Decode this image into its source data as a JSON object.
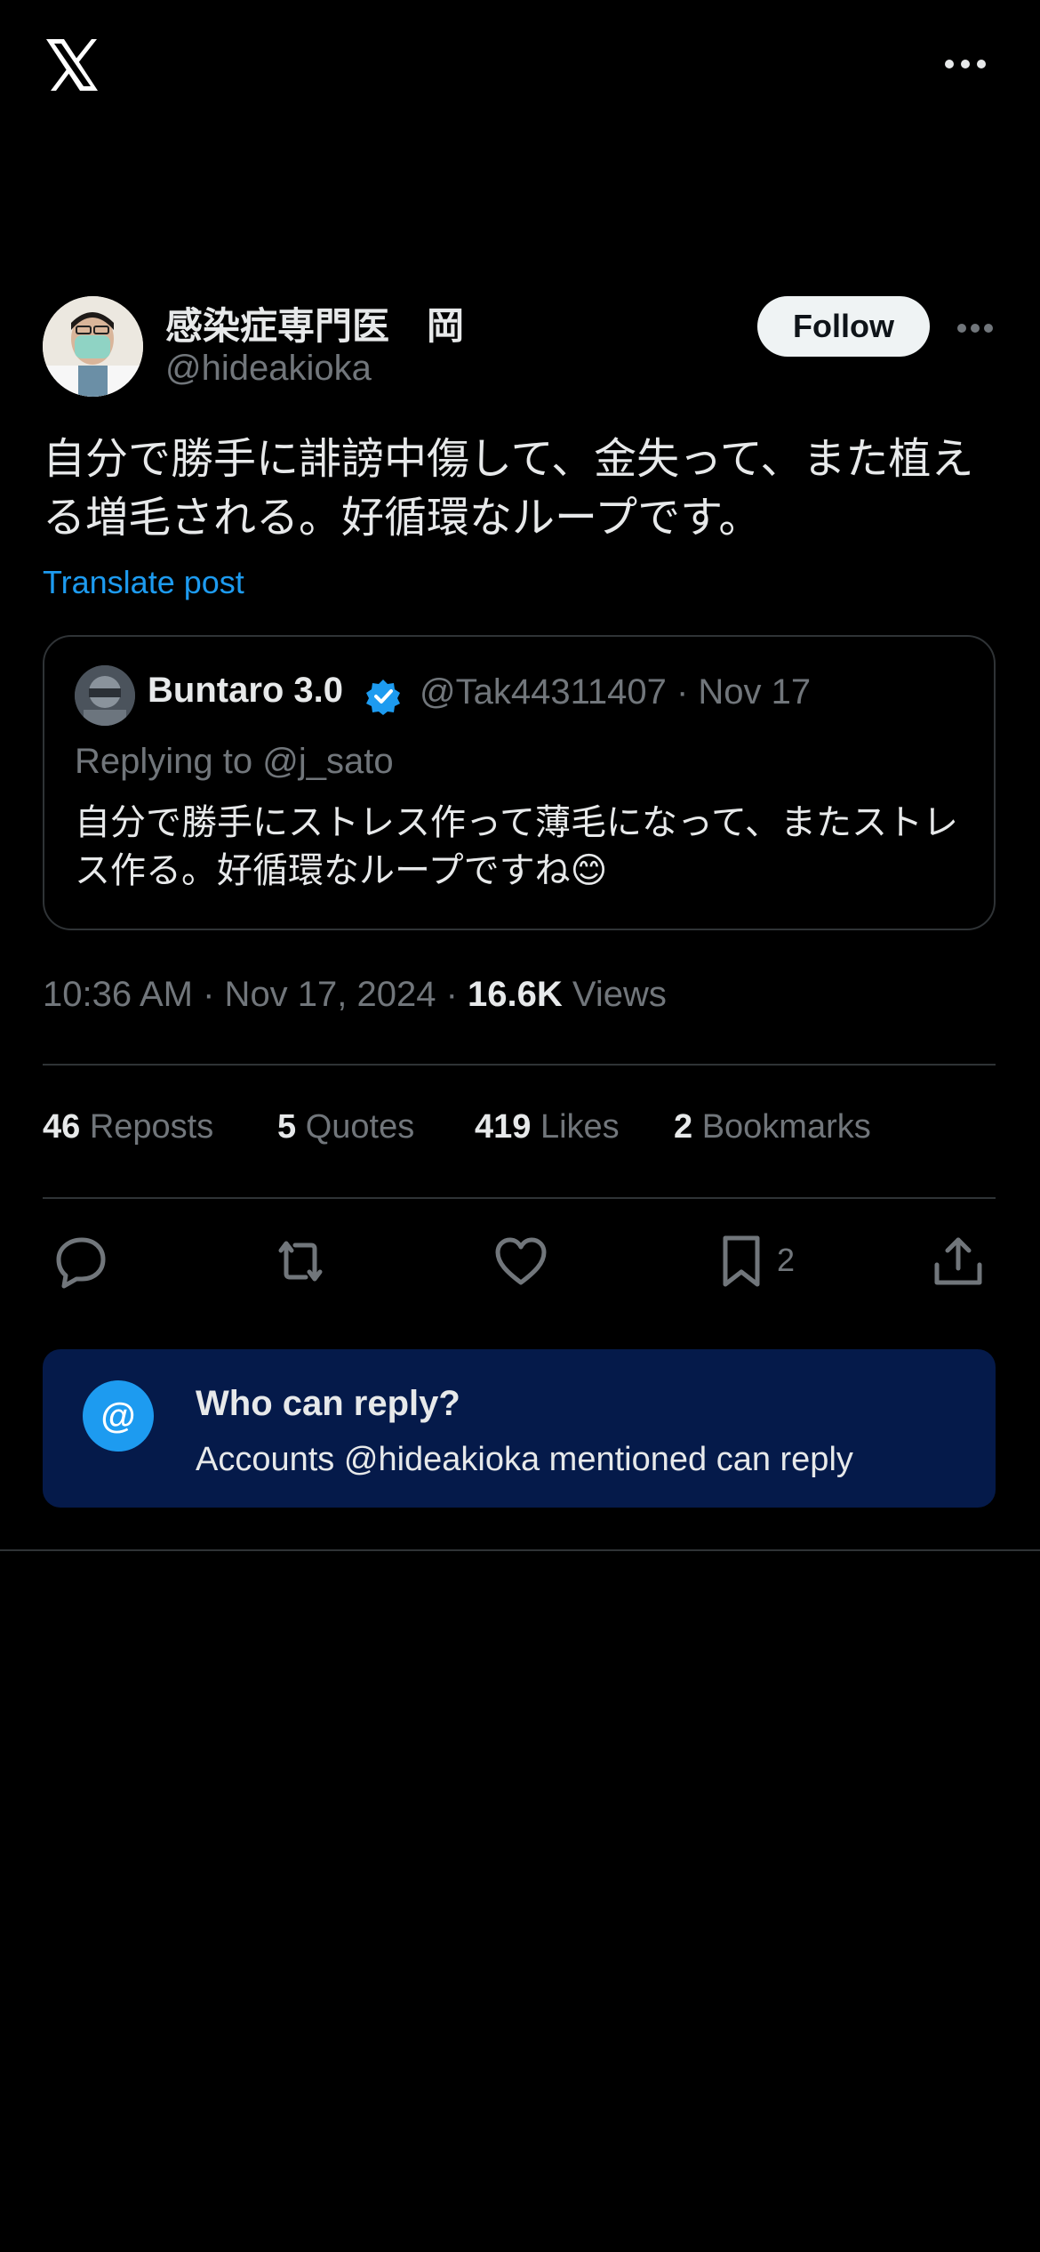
{
  "header": {
    "logo_icon": "x-logo-icon",
    "more_icon": "more-horizontal-icon"
  },
  "author": {
    "name": "感染症専門医　岡",
    "handle": "@hideakioka",
    "follow_label": "Follow"
  },
  "post": {
    "text": "自分で勝手に誹謗中傷して、金失って、また植える増毛される。好循環なループです。",
    "translate_label": "Translate post"
  },
  "quote": {
    "name": "Buntaro 3.0",
    "verified_icon": "verified-badge-icon",
    "meta": "@Tak44311407 · Nov 17",
    "replying_to": "Replying to @j_sato",
    "text": "自分で勝手にストレス作って薄毛になって、またストレス作る。好循環なループですね😊"
  },
  "meta": {
    "time_date": "10:36 AM · Nov 17, 2024 · ",
    "views_count": "16.6K",
    "views_label": " Views"
  },
  "stats": {
    "reposts_count": "46",
    "reposts_label": " Reposts",
    "quotes_count": "5",
    "quotes_label": " Quotes",
    "likes_count": "419",
    "likes_label": " Likes",
    "bookmarks_count": "2",
    "bookmarks_label": " Bookmarks"
  },
  "actions": {
    "bookmark_count": "2"
  },
  "reply_settings": {
    "symbol": "@",
    "title": "Who can reply?",
    "description": "Accounts @hideakioka mentioned can reply"
  },
  "colors": {
    "accent": "#1d9bf0",
    "background": "#000000",
    "reply_box": "#051a4a"
  }
}
